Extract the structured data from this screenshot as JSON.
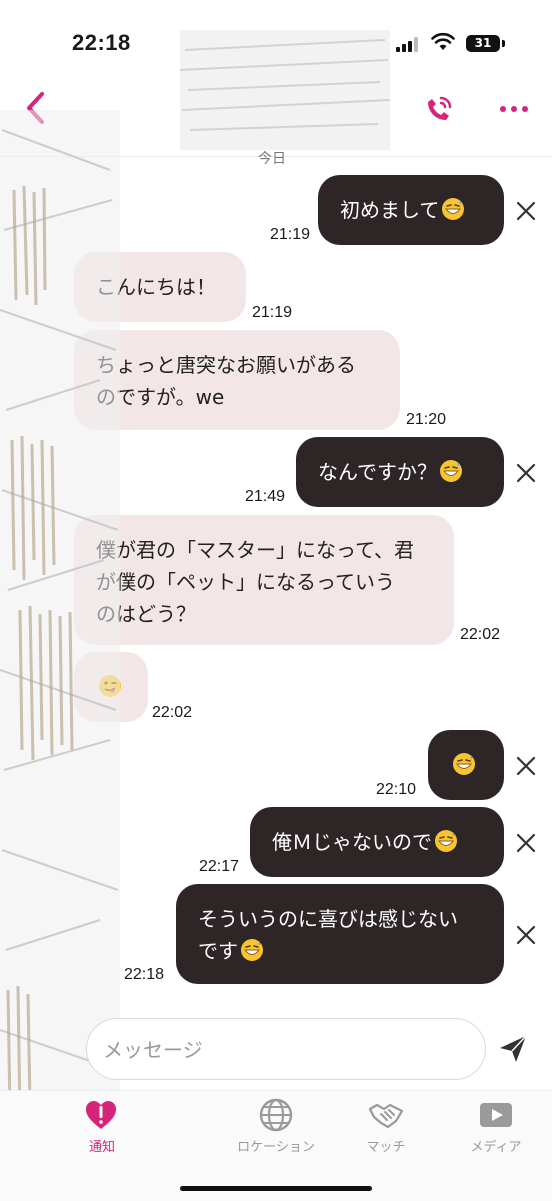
{
  "status_bar": {
    "time": "22:18",
    "battery": "31"
  },
  "header": {
    "back_icon": "chevron-left-icon",
    "call_icon": "phone-call-icon",
    "more_icon": "more-horizontal-icon",
    "accent_color": "#d6247c"
  },
  "date_separator": "今日",
  "messages": [
    {
      "side": "sent",
      "text": "初めまして",
      "emoji": "grinning-sweat",
      "time": "21:19"
    },
    {
      "side": "recv",
      "text": "こんにちは！",
      "time": "21:19"
    },
    {
      "side": "recv",
      "text": "ちょっと唐突なお願いがある\nのですが。we",
      "time": "21:20"
    },
    {
      "side": "sent",
      "text": "なんですか？",
      "emoji": "grinning-sweat",
      "time": "21:49"
    },
    {
      "side": "recv",
      "text": "僕が君の「マスター」になって、君\nが僕の「ペット」になるっていう\nのはどう？",
      "time": "22:02"
    },
    {
      "side": "recv",
      "text": "",
      "emoji": "face-tongue-wink",
      "time": "22:02"
    },
    {
      "side": "sent",
      "text": "",
      "emoji": "grinning-sweat",
      "time": "22:10"
    },
    {
      "side": "sent",
      "text": "俺Ｍじゃないので",
      "emoji": "grinning-sweat",
      "time": "22:17"
    },
    {
      "side": "sent",
      "text": "そういうのに喜びは感じない\nです",
      "emoji": "grinning-sweat",
      "time": "22:18"
    }
  ],
  "composer": {
    "placeholder": "メッセージ",
    "send_icon": "send-icon"
  },
  "tabs": [
    {
      "label": "通知",
      "icon": "heart-alert-icon",
      "active": true
    },
    {
      "label": "ロケーション",
      "icon": "globe-icon",
      "active": false
    },
    {
      "label": "マッチ",
      "icon": "handshake-icon",
      "active": false
    },
    {
      "label": "メディア",
      "icon": "play-icon",
      "active": false
    }
  ],
  "colors": {
    "sent_bubble": "#2e2626",
    "received_bubble": "#f3e6e6",
    "accent": "#d6247c"
  }
}
